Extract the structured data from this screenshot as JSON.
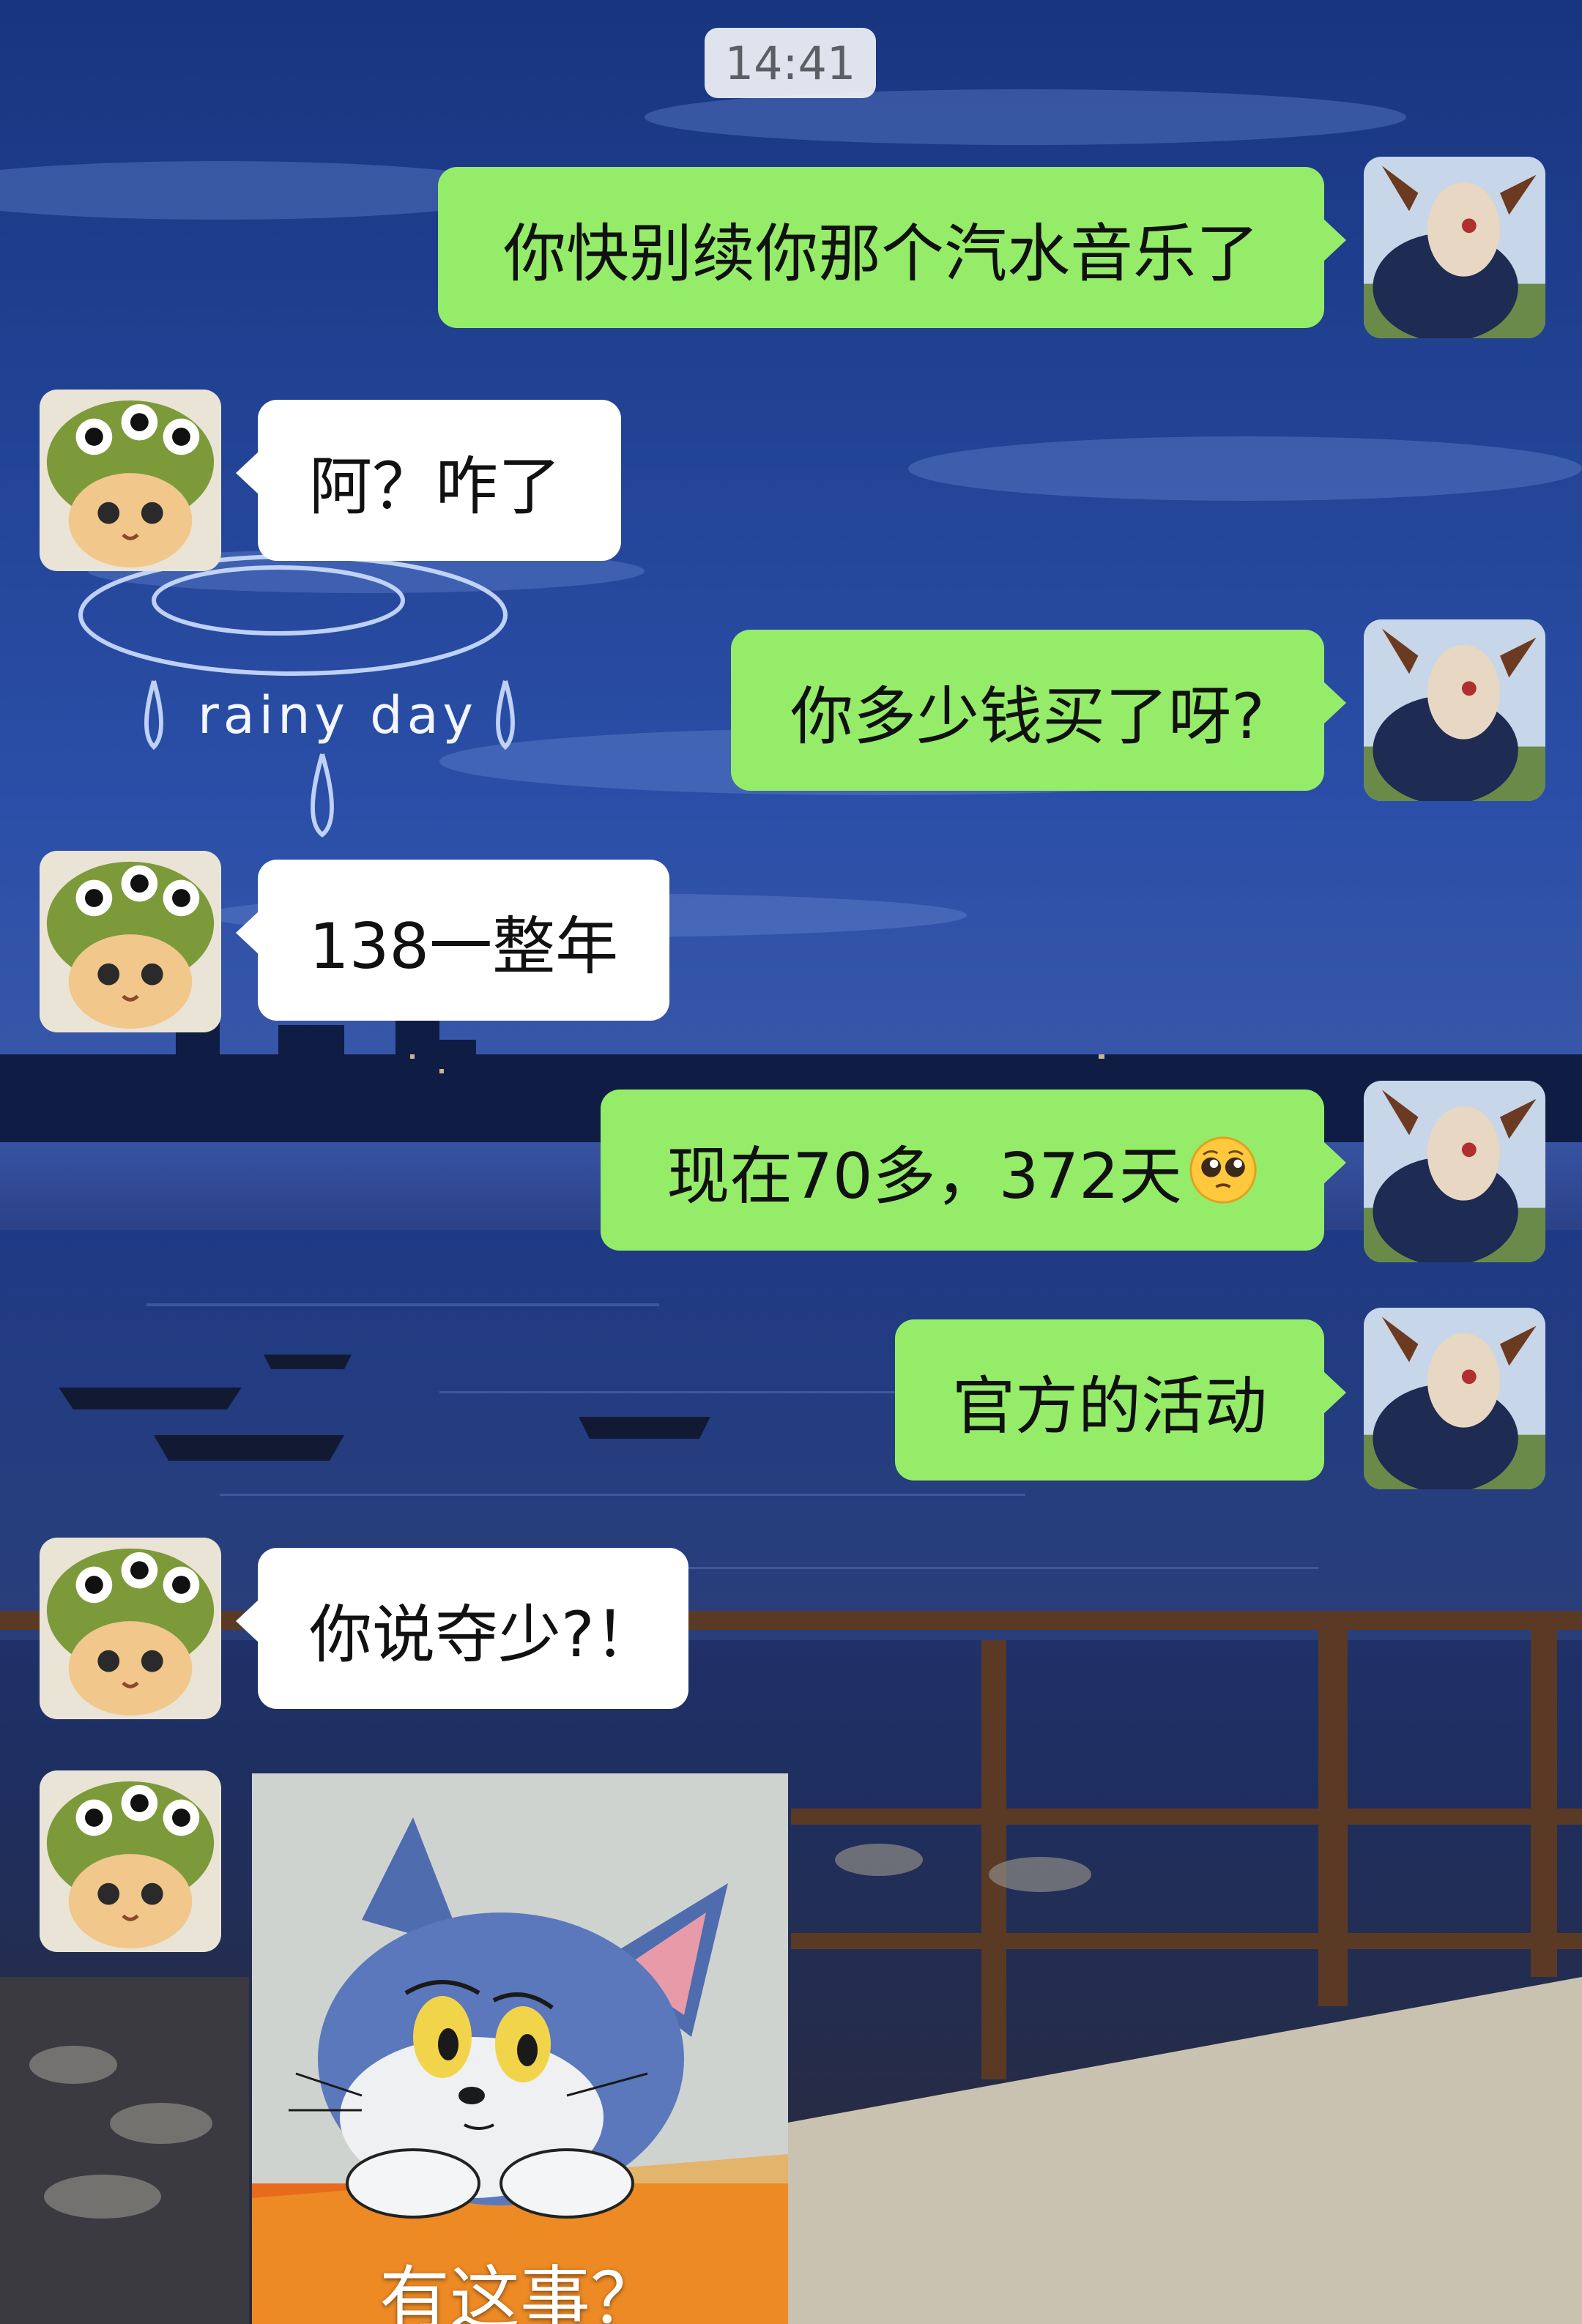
{
  "status": {
    "time": "14:41"
  },
  "wallpaper": {
    "caption": "rainy day"
  },
  "messages": [
    {
      "side": "me",
      "text": "你快别续你那个汽水音乐了"
    },
    {
      "side": "them",
      "text": "阿？咋了"
    },
    {
      "side": "me",
      "text": "你多少钱买了呀?"
    },
    {
      "side": "them",
      "text": "138一整年"
    },
    {
      "side": "me",
      "text": "现在70多，372天",
      "emoji": "pleading-face"
    },
    {
      "side": "me",
      "text": "官方的活动"
    },
    {
      "side": "them",
      "text": "你说夺少?！"
    }
  ],
  "sticker": {
    "caption": "有这事？",
    "subject": "tom-cat-sticker"
  },
  "colors": {
    "my_bubble": "#95ec69",
    "their_bubble": "#ffffff",
    "sky_top": "#1c3d8f",
    "sky_bottom": "#2a4ea3",
    "water": "#203a7a"
  }
}
